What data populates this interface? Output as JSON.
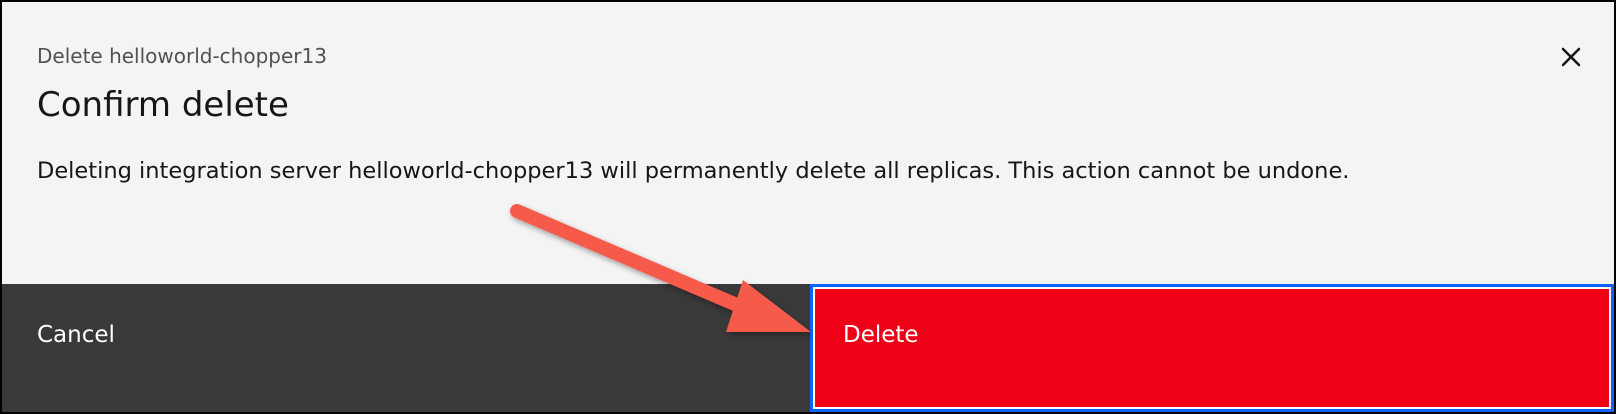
{
  "modal": {
    "label": "Delete helloworld-chopper13",
    "title": "Confirm delete",
    "message": "Deleting integration server helloworld-chopper13 will permanently delete all replicas. This action cannot be undone.",
    "close_icon": "close-icon"
  },
  "footer": {
    "cancel_label": "Cancel",
    "delete_label": "Delete"
  },
  "annotation": {
    "arrow_icon": "arrow-annotation",
    "arrow_color": "#f55a4c"
  },
  "colors": {
    "modal_background": "#f4f4f4",
    "cancel_background": "#393939",
    "danger": "#ee0017",
    "focus": "#0f62fe"
  }
}
